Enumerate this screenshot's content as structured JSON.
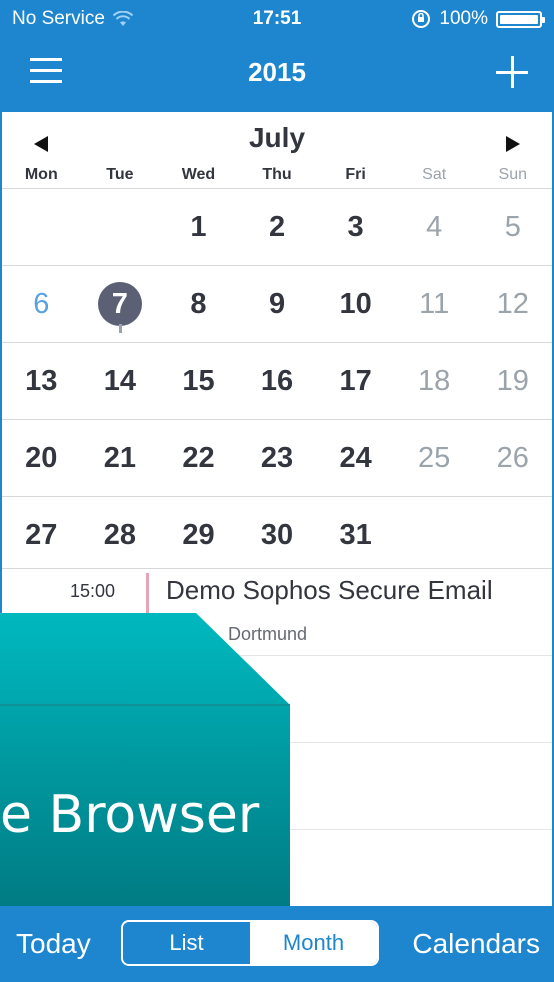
{
  "status": {
    "carrier": "No Service",
    "time": "17:51",
    "battery": "100%"
  },
  "header": {
    "title": "2015"
  },
  "calendar": {
    "month": "July",
    "weekdays": [
      "Mon",
      "Tue",
      "Wed",
      "Thu",
      "Fri",
      "Sat",
      "Sun"
    ],
    "weeks": [
      [
        "",
        "",
        "1",
        "2",
        "3",
        "4",
        "5"
      ],
      [
        "6",
        "7",
        "8",
        "9",
        "10",
        "11",
        "12"
      ],
      [
        "13",
        "14",
        "15",
        "16",
        "17",
        "18",
        "19"
      ],
      [
        "20",
        "21",
        "22",
        "23",
        "24",
        "25",
        "26"
      ],
      [
        "27",
        "28",
        "29",
        "30",
        "31",
        "",
        ""
      ]
    ],
    "today": "7"
  },
  "events": [
    {
      "time": "15:00",
      "title": "Demo Sophos Secure Email",
      "location": "Dortmund"
    }
  ],
  "overlay": {
    "text": "e Browser"
  },
  "tabbar": {
    "today": "Today",
    "list": "List",
    "month": "Month",
    "calendars": "Calendars"
  },
  "colors": {
    "accent": "#1e86cf",
    "today_circle": "#5c6075",
    "event_bar": "#e8a3b5",
    "overlay_teal": "#00aab2"
  }
}
